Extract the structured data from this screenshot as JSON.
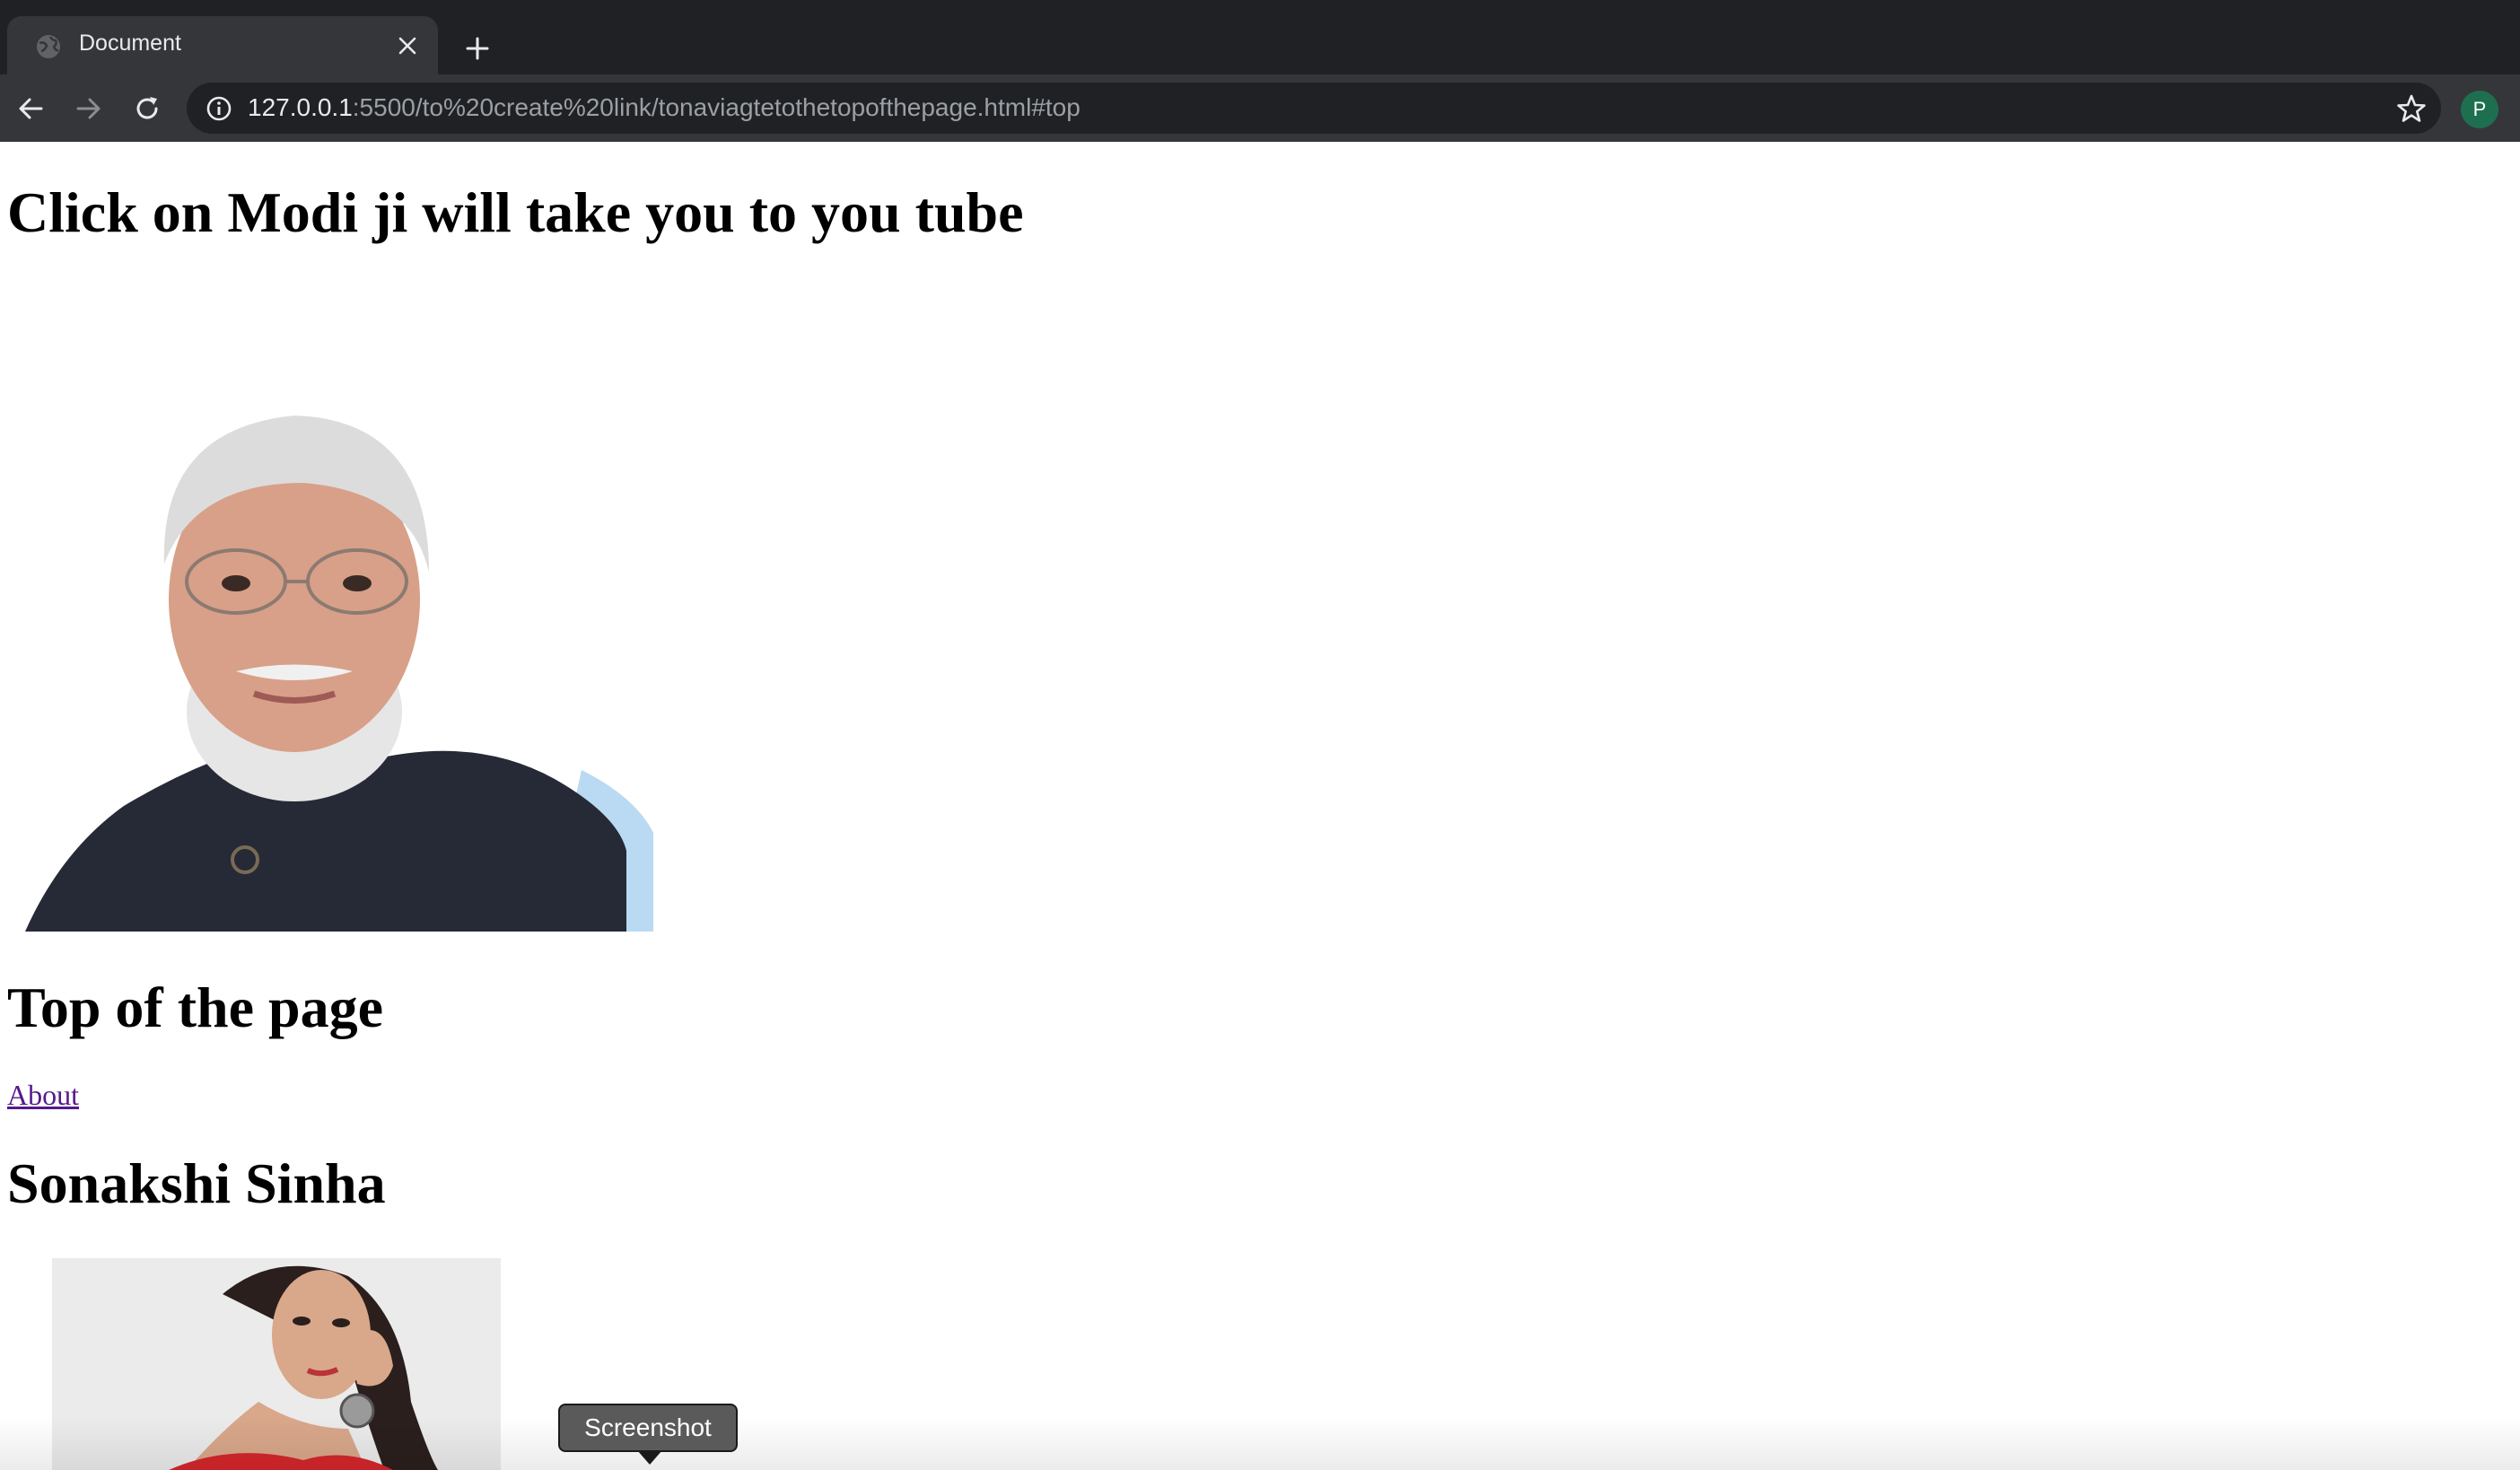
{
  "browser": {
    "tab": {
      "title": "Document",
      "favicon": "globe-icon"
    },
    "address_bar": {
      "host": "127.0.0.1",
      "rest": ":5500/to%20create%20link/tonaviagtetothetopofthepage.html#top"
    },
    "profile_initial": "P"
  },
  "page": {
    "heading1": "Click on Modi ji will take you to you tube",
    "heading2": "Top of the page",
    "about_link": "About",
    "heading3": "Sonakshi Sinha"
  },
  "overlay": {
    "tooltip": "Screenshot"
  },
  "colors": {
    "chrome_dark": "#202124",
    "chrome_tab": "#35363a",
    "visited_link": "#551a8b",
    "vest": "#262a36",
    "shirt": "#b9daf2",
    "dress": "#d4272c"
  }
}
